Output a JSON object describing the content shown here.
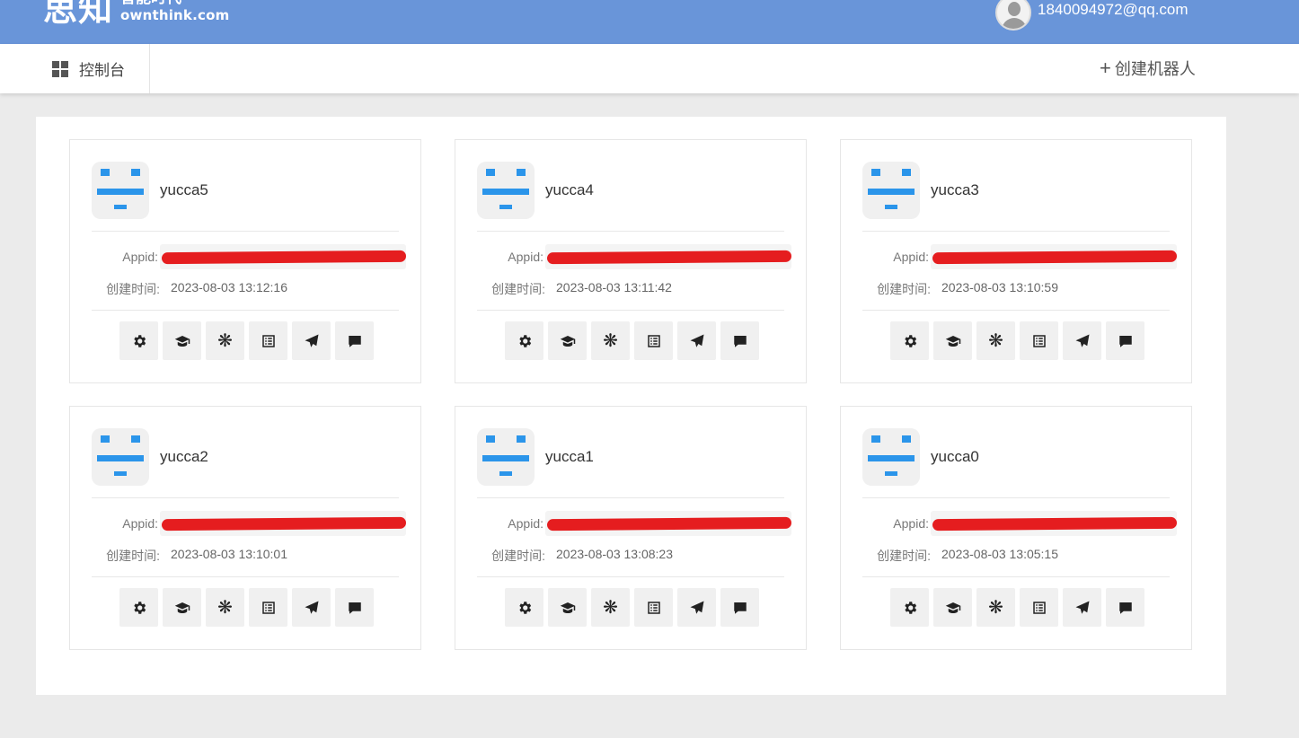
{
  "header": {
    "logo_cn": "思知",
    "logo_sub": "智能时代",
    "logo_en": "ownthink.com",
    "user_email": "1840094972@qq.com"
  },
  "nav": {
    "console_label": "控制台",
    "create_label": "创建机器人",
    "create_prefix": "+"
  },
  "labels": {
    "appid": "Appid:",
    "created": "创建时间:"
  },
  "colors": {
    "header_bg": "#6995d9",
    "robot_icon": "#2b95ea",
    "redaction": "#e51d1f"
  },
  "action_icons": [
    "gear-icon",
    "graduation-cap-icon",
    "asterisk-icon",
    "list-icon",
    "send-icon",
    "comment-icon"
  ],
  "robots": [
    {
      "name": "yucca5",
      "created": "2023-08-03 13:12:16"
    },
    {
      "name": "yucca4",
      "created": "2023-08-03 13:11:42"
    },
    {
      "name": "yucca3",
      "created": "2023-08-03 13:10:59"
    },
    {
      "name": "yucca2",
      "created": "2023-08-03 13:10:01"
    },
    {
      "name": "yucca1",
      "created": "2023-08-03 13:08:23"
    },
    {
      "name": "yucca0",
      "created": "2023-08-03 13:05:15"
    }
  ]
}
